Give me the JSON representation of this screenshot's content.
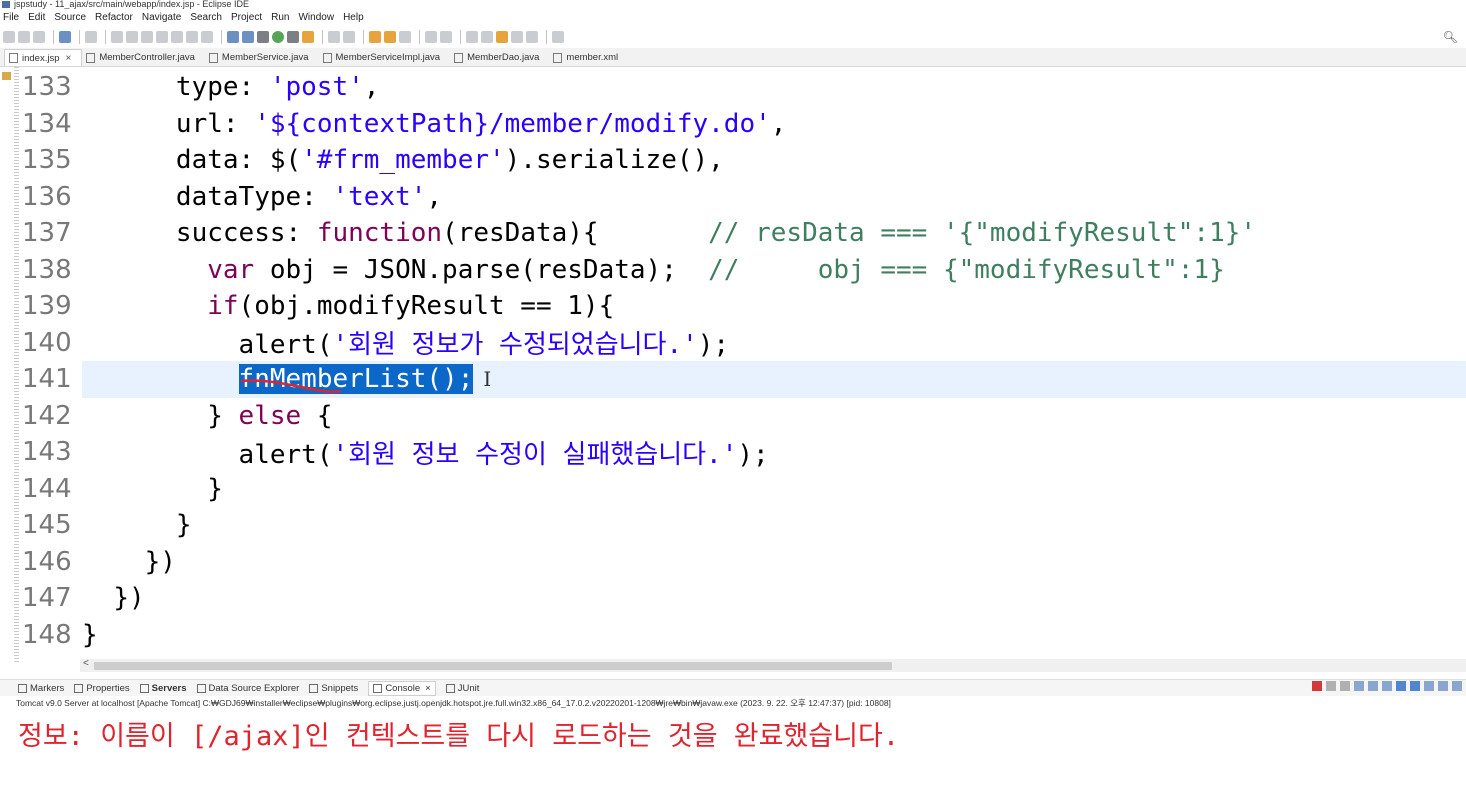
{
  "window": {
    "title": "jspstudy - 11_ajax/src/main/webapp/index.jsp - Eclipse IDE"
  },
  "menubar": {
    "items": [
      "File",
      "Edit",
      "Source",
      "Refactor",
      "Navigate",
      "Search",
      "Project",
      "Run",
      "Window",
      "Help"
    ]
  },
  "editor_tabs": [
    {
      "label": "index.jsp",
      "active": true
    },
    {
      "label": "MemberController.java"
    },
    {
      "label": "MemberService.java"
    },
    {
      "label": "MemberServiceImpl.java"
    },
    {
      "label": "MemberDao.java"
    },
    {
      "label": "member.xml"
    }
  ],
  "code_lines": [
    {
      "num": "133",
      "indent": "      ",
      "segments": [
        [
          "t",
          "type: "
        ],
        [
          "s",
          "'post'"
        ],
        [
          "t",
          ","
        ]
      ]
    },
    {
      "num": "134",
      "indent": "      ",
      "segments": [
        [
          "t",
          "url: "
        ],
        [
          "s",
          "'${contextPath}/member/modify.do'"
        ],
        [
          "t",
          ","
        ]
      ]
    },
    {
      "num": "135",
      "indent": "      ",
      "segments": [
        [
          "t",
          "data: $("
        ],
        [
          "s",
          "'#frm_member'"
        ],
        [
          "t",
          ").serialize(),"
        ]
      ]
    },
    {
      "num": "136",
      "indent": "      ",
      "segments": [
        [
          "t",
          "dataType: "
        ],
        [
          "s",
          "'text'"
        ],
        [
          "t",
          ","
        ]
      ]
    },
    {
      "num": "137",
      "indent": "      ",
      "segments": [
        [
          "t",
          "success: "
        ],
        [
          "k",
          "function"
        ],
        [
          "t",
          "(resData){       "
        ],
        [
          "c",
          "// resData === '{\"modifyResult\":1}'"
        ]
      ]
    },
    {
      "num": "138",
      "indent": "        ",
      "segments": [
        [
          "k",
          "var"
        ],
        [
          "t",
          " obj = JSON.parse(resData);  "
        ],
        [
          "c",
          "//     obj === {\"modifyResult\":1}"
        ]
      ]
    },
    {
      "num": "139",
      "indent": "        ",
      "segments": [
        [
          "k",
          "if"
        ],
        [
          "t",
          "(obj.modifyResult == 1){"
        ]
      ]
    },
    {
      "num": "140",
      "indent": "          ",
      "segments": [
        [
          "t",
          "alert("
        ],
        [
          "s",
          "'회원 정보가 수정되었습니다.'"
        ],
        [
          "t",
          ");"
        ]
      ]
    },
    {
      "num": "141",
      "indent": "          ",
      "current": true,
      "segments": [
        [
          "sel",
          "fnMemberList();"
        ]
      ]
    },
    {
      "num": "142",
      "indent": "        ",
      "segments": [
        [
          "t",
          "} "
        ],
        [
          "k",
          "else"
        ],
        [
          "t",
          " {"
        ]
      ]
    },
    {
      "num": "143",
      "indent": "          ",
      "segments": [
        [
          "t",
          "alert("
        ],
        [
          "s",
          "'회원 정보 수정이 실패했습니다.'"
        ],
        [
          "t",
          ");"
        ]
      ]
    },
    {
      "num": "144",
      "indent": "        ",
      "segments": [
        [
          "t",
          "}"
        ]
      ]
    },
    {
      "num": "145",
      "indent": "      ",
      "segments": [
        [
          "t",
          "}"
        ]
      ]
    },
    {
      "num": "146",
      "indent": "    ",
      "segments": [
        [
          "t",
          "})"
        ]
      ]
    },
    {
      "num": "147",
      "indent": "  ",
      "segments": [
        [
          "t",
          "})"
        ]
      ]
    },
    {
      "num": "148",
      "indent": "",
      "segments": [
        [
          "t",
          "}"
        ]
      ]
    }
  ],
  "panel_tabs": [
    {
      "label": "Markers"
    },
    {
      "label": "Properties"
    },
    {
      "label": "Servers",
      "bold": true
    },
    {
      "label": "Data Source Explorer"
    },
    {
      "label": "Snippets"
    },
    {
      "label": "Console",
      "active": true
    },
    {
      "label": "JUnit"
    }
  ],
  "console": {
    "process_info": "Tomcat v9.0 Server at localhost [Apache Tomcat] C:₩GDJ69₩installer₩eclipse₩plugins₩org.eclipse.justj.openjdk.hotspot.jre.full.win32.x86_64_17.0.2.v20220201-1208₩jre₩bin₩javaw.exe  (2023. 9. 22. 오후 12:47:37) [pid: 10808]",
    "output": "정보: 이름이 [/ajax]인 컨텍스트를 다시 로드하는 것을 완료했습니다."
  },
  "colors": {
    "keyword": "#7f0055",
    "string": "#2a00ff",
    "comment": "#3f7f5f",
    "selection": "#0b68c9",
    "console_error": "#e0242f",
    "current_line": "#e8f2fe"
  }
}
